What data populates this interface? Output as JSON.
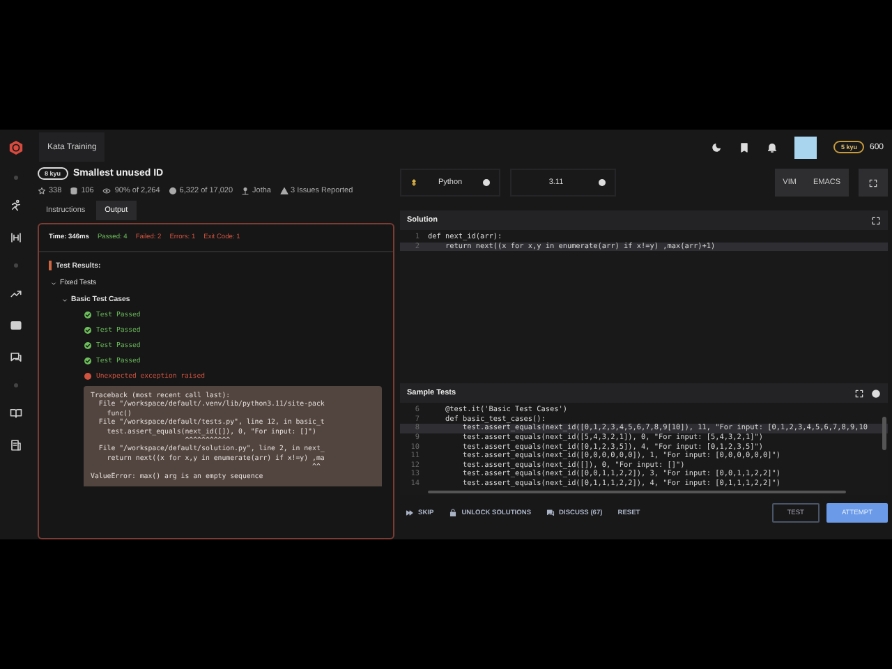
{
  "top_bar": {
    "tab": "Kata Training",
    "rank": "5 kyu",
    "honor": "600"
  },
  "kata": {
    "rank": "8 kyu",
    "title": "Smallest unused ID",
    "stats": [
      {
        "kind": "stars",
        "text": "338"
      },
      {
        "kind": "collections",
        "text": "106"
      },
      {
        "kind": "satisfaction",
        "text": "90% of 2,264"
      },
      {
        "kind": "completions",
        "text": "6,322 of 17,020"
      },
      {
        "kind": "author",
        "text": "Jotha"
      },
      {
        "kind": "issues",
        "text": "3 Issues Reported"
      }
    ]
  },
  "tabs": [
    {
      "label": "Instructions",
      "selected": false
    },
    {
      "label": "Output",
      "selected": true
    }
  ],
  "output": {
    "summary": [
      {
        "kind": "time",
        "text": "Time: 346ms"
      },
      {
        "kind": "passed",
        "text": "Passed: 4"
      },
      {
        "kind": "failed",
        "text": "Failed: 2"
      },
      {
        "kind": "failed",
        "text": "Errors: 1"
      },
      {
        "kind": "failed",
        "text": "Exit Code: 1"
      }
    ],
    "heading": "Test Results:",
    "tree": [
      {
        "label": "Fixed Tests",
        "expanded": true,
        "children": [
          {
            "label": "Basic Test Cases",
            "expanded": true,
            "results": [
              {
                "kind": "passed",
                "text": "Test Passed"
              },
              {
                "kind": "passed",
                "text": "Test Passed"
              },
              {
                "kind": "passed",
                "text": "Test Passed"
              },
              {
                "kind": "passed",
                "text": "Test Passed"
              },
              {
                "kind": "error",
                "text": "Unexpected exception raised",
                "traceback": [
                  "Traceback (most recent call last):",
                  "  File \"/workspace/default/.venv/lib/python3.11/site-pack",
                  "    func()",
                  "  File \"/workspace/default/tests.py\", line 12, in basic_t",
                  "    test.assert_equals(next_id([]), 0, \"For input: []\")",
                  "                       ^^^^^^^^^^^",
                  "  File \"/workspace/default/solution.py\", line 2, in next_",
                  "    return next((x for x,y in enumerate(arr) if x!=y) ,ma",
                  "                                                      ^^",
                  "ValueError: max() arg is an empty sequence"
                ]
              }
            ]
          }
        ]
      }
    ]
  },
  "editor": {
    "language": "Python",
    "version": "3.11",
    "modes": [
      "VIM",
      "EMACS"
    ]
  },
  "solution": {
    "title": "Solution",
    "lines": [
      {
        "number": "1",
        "code": "def next_id(arr):",
        "active": false
      },
      {
        "number": "2",
        "code": "    return next((x for x,y in enumerate(arr) if x!=y) ,max(arr)+1)",
        "active": true
      }
    ]
  },
  "sample_tests": {
    "title": "Sample Tests",
    "lines": [
      {
        "number": "6",
        "code": "    @test.it('Basic Test Cases')",
        "active": false
      },
      {
        "number": "7",
        "code": "    def basic_test_cases():",
        "active": false
      },
      {
        "number": "8",
        "code": "        test.assert_equals(next_id([0,1,2,3,4,5,6,7,8,9[10]), 11, \"For input: [0,1,2,3,4,5,6,7,8,9,10",
        "active": true
      },
      {
        "number": "9",
        "code": "        test.assert_equals(next_id([5,4,3,2,1]), 0, \"For input: [5,4,3,2,1]\")",
        "active": false
      },
      {
        "number": "10",
        "code": "        test.assert_equals(next_id([0,1,2,3,5]), 4, \"For input: [0,1,2,3,5]\")",
        "active": false
      },
      {
        "number": "11",
        "code": "        test.assert_equals(next_id([0,0,0,0,0,0]), 1, \"For input: [0,0,0,0,0,0]\")",
        "active": false
      },
      {
        "number": "12",
        "code": "        test.assert_equals(next_id([]), 0, \"For input: []\")",
        "active": false
      },
      {
        "number": "13",
        "code": "        test.assert_equals(next_id([0,0,1,1,2,2]), 3, \"For input: [0,0,1,1,2,2]\")",
        "active": false
      },
      {
        "number": "14",
        "code": "        test.assert_equals(next_id([0,1,1,1,2,2]), 4, \"For input: [0,1,1,1,2,2]\")",
        "active": false
      }
    ]
  },
  "actions": [
    {
      "kind": "skip",
      "label": "SKIP"
    },
    {
      "kind": "unlock",
      "label": "UNLOCK SOLUTIONS"
    },
    {
      "kind": "discuss",
      "label": "DISCUSS (67)"
    },
    {
      "kind": "reset",
      "label": "RESET"
    }
  ],
  "buttons": [
    {
      "kind": "outline",
      "label": "TEST"
    },
    {
      "kind": "primary",
      "label": "ATTEMPT"
    }
  ]
}
